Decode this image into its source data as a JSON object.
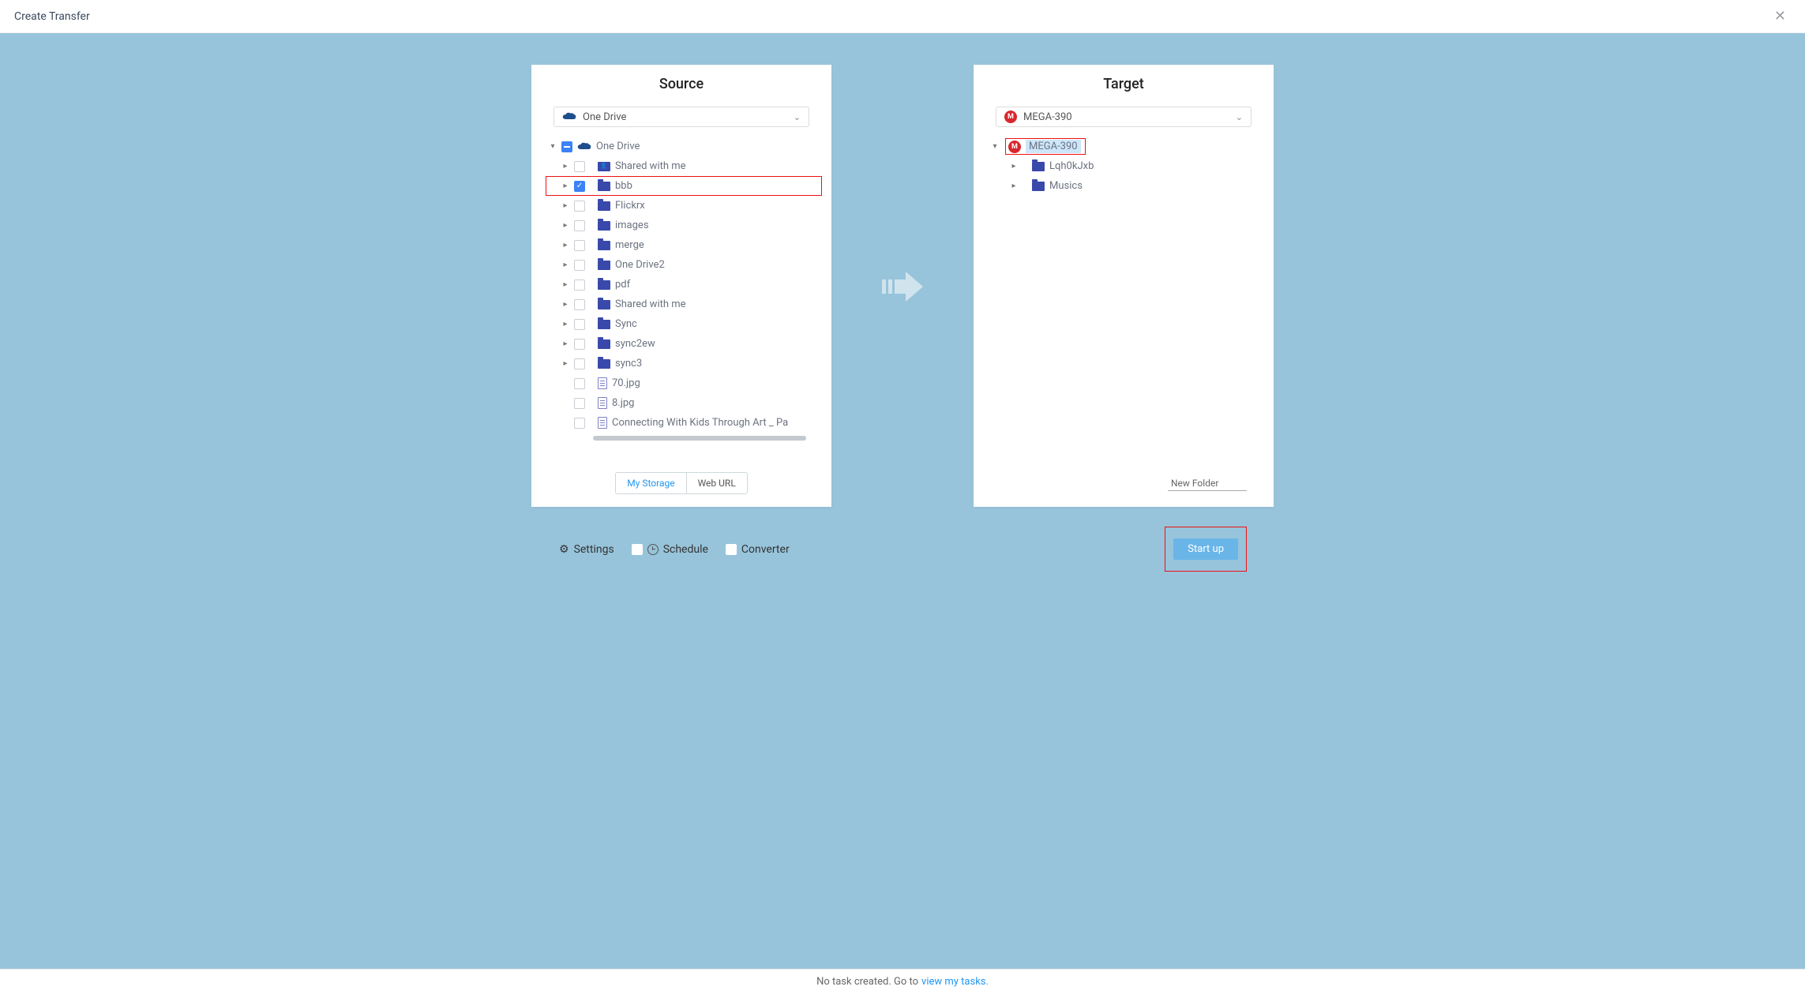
{
  "header": {
    "title": "Create Transfer"
  },
  "source": {
    "title": "Source",
    "cloud": "One Drive",
    "root": "One Drive",
    "folders": [
      {
        "name": "Shared with me",
        "type": "shared",
        "checked": false
      },
      {
        "name": "bbb",
        "type": "folder",
        "checked": true,
        "highlight": true
      },
      {
        "name": "Flickrx",
        "type": "folder",
        "checked": false
      },
      {
        "name": "images",
        "type": "folder",
        "checked": false
      },
      {
        "name": "merge",
        "type": "folder",
        "checked": false
      },
      {
        "name": "One Drive2",
        "type": "folder",
        "checked": false
      },
      {
        "name": "pdf",
        "type": "folder",
        "checked": false
      },
      {
        "name": "Shared with me",
        "type": "folder",
        "checked": false
      },
      {
        "name": "Sync",
        "type": "folder",
        "checked": false
      },
      {
        "name": "sync2ew",
        "type": "folder",
        "checked": false
      },
      {
        "name": "sync3",
        "type": "folder",
        "checked": false
      }
    ],
    "files": [
      {
        "name": "70.jpg"
      },
      {
        "name": "8.jpg"
      },
      {
        "name": "Connecting With Kids Through Art _ Pa"
      }
    ],
    "tabs": {
      "my_storage": "My Storage",
      "web_url": "Web URL"
    }
  },
  "target": {
    "title": "Target",
    "cloud": "MEGA-390",
    "root": "MEGA-390",
    "folders": [
      {
        "name": "Lqh0kJxb"
      },
      {
        "name": "Musics"
      }
    ],
    "new_folder_label": "New Folder"
  },
  "actions": {
    "settings": "Settings",
    "schedule": "Schedule",
    "converter": "Converter",
    "start": "Start up"
  },
  "footer": {
    "text": "No task created. Go to",
    "link": "view my tasks."
  }
}
